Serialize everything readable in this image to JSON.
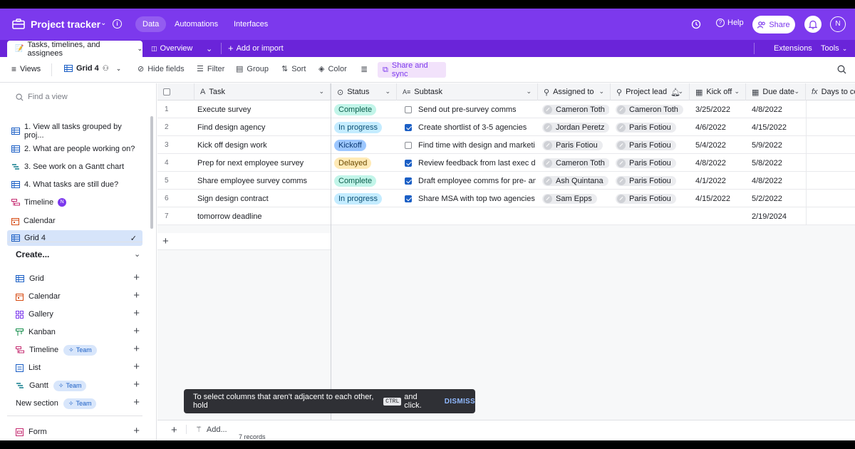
{
  "topbar": {
    "base_title": "Project tracker",
    "tabs": [
      "Data",
      "Automations",
      "Interfaces"
    ],
    "help_label": "Help",
    "share_label": "Share",
    "avatar_initial": "N",
    "color": "#7c39ed"
  },
  "tabbar": {
    "table_tab": "Tasks, timelines, and assignees",
    "overview": "Overview",
    "add_import": "Add or import",
    "extensions": "Extensions",
    "tools": "Tools"
  },
  "viewbar": {
    "views": "Views",
    "current_view": "Grid 4",
    "hide_fields": "Hide fields",
    "filter": "Filter",
    "group": "Group",
    "sort": "Sort",
    "color": "Color",
    "share_sync": "Share and sync"
  },
  "sidebar": {
    "find_placeholder": "Find a view",
    "views": [
      {
        "label": "1. View all tasks grouped by proj...",
        "icon": "grid-icon"
      },
      {
        "label": "2. What are people working on?",
        "icon": "grid-icon"
      },
      {
        "label": "3. See work on a Gantt chart",
        "icon": "gantt-icon"
      },
      {
        "label": "4. What tasks are still due?",
        "icon": "grid-icon"
      },
      {
        "label": "Timeline",
        "icon": "timeline-icon",
        "badge": "N"
      },
      {
        "label": "Calendar",
        "icon": "calendar-icon"
      },
      {
        "label": "Grid 4",
        "icon": "grid-icon",
        "active": true
      }
    ],
    "create_label": "Create...",
    "create_items": [
      {
        "label": "Grid",
        "icon": "grid-icon"
      },
      {
        "label": "Calendar",
        "icon": "calendar-icon"
      },
      {
        "label": "Gallery",
        "icon": "gallery-icon"
      },
      {
        "label": "Kanban",
        "icon": "kanban-icon"
      },
      {
        "label": "Timeline",
        "icon": "timeline-icon",
        "team": "Team"
      },
      {
        "label": "List",
        "icon": "list-icon"
      },
      {
        "label": "Gantt",
        "icon": "gantt-icon",
        "team": "Team"
      },
      {
        "label": "New section",
        "team": "Team"
      },
      {
        "label": "Form",
        "icon": "form-icon"
      }
    ]
  },
  "grid": {
    "columns": [
      "Task",
      "Status",
      "Subtask",
      "Assigned to",
      "Project lead",
      "Kick off",
      "Due date",
      "Days to co"
    ],
    "rows": [
      {
        "num": "1",
        "task": "Execute survey",
        "status": "Complete",
        "checked": false,
        "subtask": "Send out pre-survey comms",
        "assigned": "Cameron Toth",
        "lead": "Cameron Toth",
        "kickoff": "3/25/2022",
        "due": "4/8/2022"
      },
      {
        "num": "2",
        "task": "Find design agency",
        "status": "In progress",
        "checked": true,
        "subtask": "Create shortlist of 3-5 agencies",
        "assigned": "Jordan Peretz",
        "lead": "Paris Fotiou",
        "kickoff": "4/6/2022",
        "due": "4/15/2022"
      },
      {
        "num": "3",
        "task": "Kick off design work",
        "status": "Kickoff",
        "checked": false,
        "subtask": "Find time with design and marketi...",
        "assigned": "Paris Fotiou",
        "lead": "Paris Fotiou",
        "kickoff": "5/4/2022",
        "due": "5/9/2022"
      },
      {
        "num": "4",
        "task": "Prep for next employee survey",
        "status": "Delayed",
        "checked": true,
        "subtask": "Review feedback from last exec de...",
        "assigned": "Cameron Toth",
        "lead": "Paris Fotiou",
        "kickoff": "4/8/2022",
        "due": "5/8/2022"
      },
      {
        "num": "5",
        "task": "Share employee survey comms",
        "status": "Complete",
        "checked": true,
        "subtask": "Draft employee comms for pre- an...",
        "assigned": "Ash Quintana",
        "lead": "Paris Fotiou",
        "kickoff": "4/1/2022",
        "due": "4/8/2022"
      },
      {
        "num": "6",
        "task": "Sign design contract",
        "status": "In progress",
        "checked": true,
        "subtask": "Share MSA with top two agencies",
        "assigned": "Sam Epps",
        "lead": "Paris Fotiou",
        "kickoff": "4/15/2022",
        "due": "5/2/2022"
      },
      {
        "num": "7",
        "task": "tomorrow deadline",
        "status": "",
        "checked": null,
        "subtask": "",
        "assigned": "",
        "lead": "",
        "kickoff": "",
        "due": "2/19/2024"
      }
    ],
    "status_colors": {
      "Complete": {
        "bg": "#c2f5e9",
        "fg": "#0b5e4d"
      },
      "In progress": {
        "bg": "#c4ecff",
        "fg": "#0b4f73"
      },
      "Kickoff": {
        "bg": "#9cc7ff",
        "fg": "#0d3a73"
      },
      "Delayed": {
        "bg": "#ffeab6",
        "fg": "#6a4a00"
      }
    },
    "add_label": "Add...",
    "record_count": "7 records"
  },
  "toast": {
    "text_before": "To select columns that aren't adjacent to each other, hold",
    "key": "CTRL",
    "text_after": "and click.",
    "dismiss": "DISMISS"
  }
}
